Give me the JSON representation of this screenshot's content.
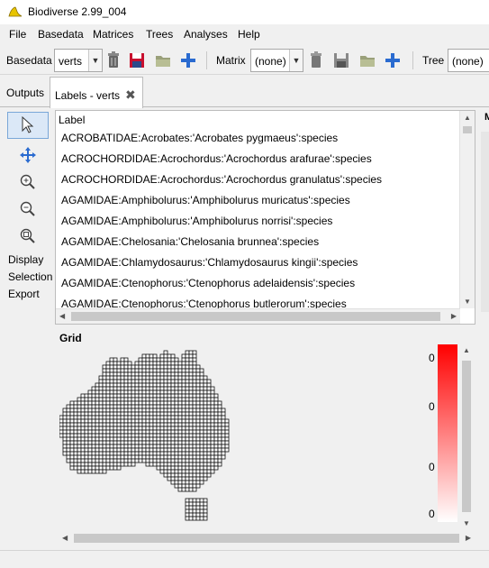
{
  "window": {
    "title": "Biodiverse 2.99_004"
  },
  "menu": [
    "File",
    "Basedata",
    "Matrices",
    "Trees",
    "Analyses",
    "Help"
  ],
  "toolbar": {
    "basedata_label": "Basedata",
    "basedata_value": "verts",
    "matrix_label": "Matrix",
    "matrix_value": "(none)",
    "tree_label": "Tree",
    "tree_value": "(none)"
  },
  "tabs": {
    "outputs": "Outputs",
    "labels": "Labels - verts"
  },
  "tools": {
    "display": "Display",
    "selection": "Selection",
    "export": "Export"
  },
  "list": {
    "header": "Label",
    "rows": [
      "ACROBATIDAE:Acrobates:'Acrobates pygmaeus':species",
      "ACROCHORDIDAE:Acrochordus:'Acrochordus arafurae':species",
      "ACROCHORDIDAE:Acrochordus:'Acrochordus granulatus':species",
      "AGAMIDAE:Amphibolurus:'Amphibolurus muricatus':species",
      "AGAMIDAE:Amphibolurus:'Amphibolurus norrisi':species",
      "AGAMIDAE:Chelosania:'Chelosania brunnea':species",
      "AGAMIDAE:Chlamydosaurus:'Chlamydosaurus kingii':species",
      "AGAMIDAE:Ctenophorus:'Ctenophorus adelaidensis':species",
      "AGAMIDAE:Ctenophorus:'Ctenophorus butlerorum':species"
    ]
  },
  "grid": {
    "label": "Grid",
    "legend_values": [
      "0",
      "0",
      "0",
      "0"
    ],
    "legend_top_color": "#ff0000",
    "legend_bottom_color": "#ffffff"
  }
}
